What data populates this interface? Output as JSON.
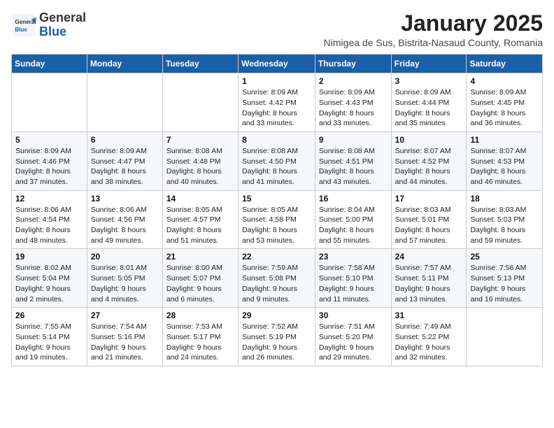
{
  "header": {
    "logo_general": "General",
    "logo_blue": "Blue",
    "month_title": "January 2025",
    "subtitle": "Nimigea de Sus, Bistrita-Nasaud County, Romania"
  },
  "weekdays": [
    "Sunday",
    "Monday",
    "Tuesday",
    "Wednesday",
    "Thursday",
    "Friday",
    "Saturday"
  ],
  "weeks": [
    [
      {
        "day": "",
        "info": ""
      },
      {
        "day": "",
        "info": ""
      },
      {
        "day": "",
        "info": ""
      },
      {
        "day": "1",
        "info": "Sunrise: 8:09 AM\nSunset: 4:42 PM\nDaylight: 8 hours and 33 minutes."
      },
      {
        "day": "2",
        "info": "Sunrise: 8:09 AM\nSunset: 4:43 PM\nDaylight: 8 hours and 33 minutes."
      },
      {
        "day": "3",
        "info": "Sunrise: 8:09 AM\nSunset: 4:44 PM\nDaylight: 8 hours and 35 minutes."
      },
      {
        "day": "4",
        "info": "Sunrise: 8:09 AM\nSunset: 4:45 PM\nDaylight: 8 hours and 36 minutes."
      }
    ],
    [
      {
        "day": "5",
        "info": "Sunrise: 8:09 AM\nSunset: 4:46 PM\nDaylight: 8 hours and 37 minutes."
      },
      {
        "day": "6",
        "info": "Sunrise: 8:09 AM\nSunset: 4:47 PM\nDaylight: 8 hours and 38 minutes."
      },
      {
        "day": "7",
        "info": "Sunrise: 8:08 AM\nSunset: 4:48 PM\nDaylight: 8 hours and 40 minutes."
      },
      {
        "day": "8",
        "info": "Sunrise: 8:08 AM\nSunset: 4:50 PM\nDaylight: 8 hours and 41 minutes."
      },
      {
        "day": "9",
        "info": "Sunrise: 8:08 AM\nSunset: 4:51 PM\nDaylight: 8 hours and 43 minutes."
      },
      {
        "day": "10",
        "info": "Sunrise: 8:07 AM\nSunset: 4:52 PM\nDaylight: 8 hours and 44 minutes."
      },
      {
        "day": "11",
        "info": "Sunrise: 8:07 AM\nSunset: 4:53 PM\nDaylight: 8 hours and 46 minutes."
      }
    ],
    [
      {
        "day": "12",
        "info": "Sunrise: 8:06 AM\nSunset: 4:54 PM\nDaylight: 8 hours and 48 minutes."
      },
      {
        "day": "13",
        "info": "Sunrise: 8:06 AM\nSunset: 4:56 PM\nDaylight: 8 hours and 49 minutes."
      },
      {
        "day": "14",
        "info": "Sunrise: 8:05 AM\nSunset: 4:57 PM\nDaylight: 8 hours and 51 minutes."
      },
      {
        "day": "15",
        "info": "Sunrise: 8:05 AM\nSunset: 4:58 PM\nDaylight: 8 hours and 53 minutes."
      },
      {
        "day": "16",
        "info": "Sunrise: 8:04 AM\nSunset: 5:00 PM\nDaylight: 8 hours and 55 minutes."
      },
      {
        "day": "17",
        "info": "Sunrise: 8:03 AM\nSunset: 5:01 PM\nDaylight: 8 hours and 57 minutes."
      },
      {
        "day": "18",
        "info": "Sunrise: 8:03 AM\nSunset: 5:03 PM\nDaylight: 8 hours and 59 minutes."
      }
    ],
    [
      {
        "day": "19",
        "info": "Sunrise: 8:02 AM\nSunset: 5:04 PM\nDaylight: 9 hours and 2 minutes."
      },
      {
        "day": "20",
        "info": "Sunrise: 8:01 AM\nSunset: 5:05 PM\nDaylight: 9 hours and 4 minutes."
      },
      {
        "day": "21",
        "info": "Sunrise: 8:00 AM\nSunset: 5:07 PM\nDaylight: 9 hours and 6 minutes."
      },
      {
        "day": "22",
        "info": "Sunrise: 7:59 AM\nSunset: 5:08 PM\nDaylight: 9 hours and 9 minutes."
      },
      {
        "day": "23",
        "info": "Sunrise: 7:58 AM\nSunset: 5:10 PM\nDaylight: 9 hours and 11 minutes."
      },
      {
        "day": "24",
        "info": "Sunrise: 7:57 AM\nSunset: 5:11 PM\nDaylight: 9 hours and 13 minutes."
      },
      {
        "day": "25",
        "info": "Sunrise: 7:56 AM\nSunset: 5:13 PM\nDaylight: 9 hours and 16 minutes."
      }
    ],
    [
      {
        "day": "26",
        "info": "Sunrise: 7:55 AM\nSunset: 5:14 PM\nDaylight: 9 hours and 19 minutes."
      },
      {
        "day": "27",
        "info": "Sunrise: 7:54 AM\nSunset: 5:16 PM\nDaylight: 9 hours and 21 minutes."
      },
      {
        "day": "28",
        "info": "Sunrise: 7:53 AM\nSunset: 5:17 PM\nDaylight: 9 hours and 24 minutes."
      },
      {
        "day": "29",
        "info": "Sunrise: 7:52 AM\nSunset: 5:19 PM\nDaylight: 9 hours and 26 minutes."
      },
      {
        "day": "30",
        "info": "Sunrise: 7:51 AM\nSunset: 5:20 PM\nDaylight: 9 hours and 29 minutes."
      },
      {
        "day": "31",
        "info": "Sunrise: 7:49 AM\nSunset: 5:22 PM\nDaylight: 9 hours and 32 minutes."
      },
      {
        "day": "",
        "info": ""
      }
    ]
  ]
}
